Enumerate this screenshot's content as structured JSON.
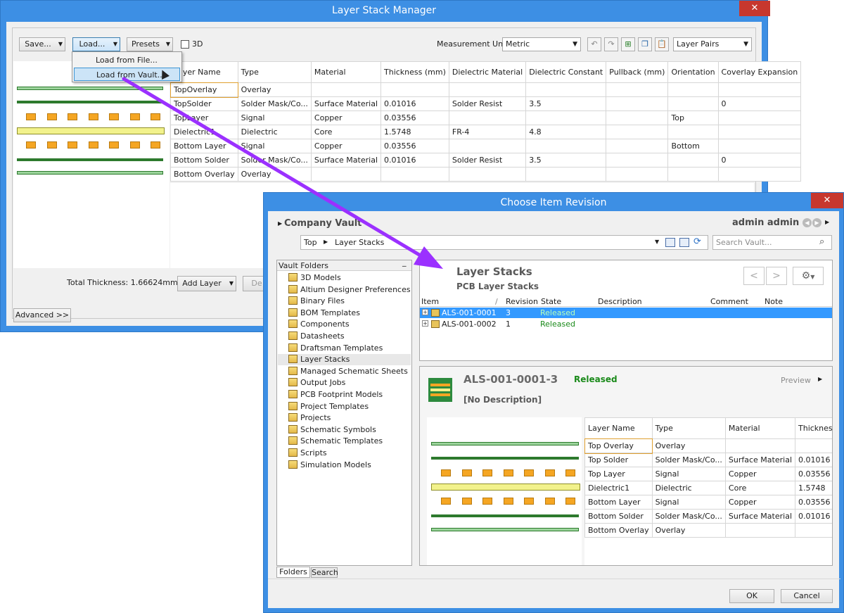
{
  "lsm": {
    "title": "Layer Stack Manager",
    "close": "✕",
    "toolbar": {
      "save": "Save...",
      "load": "Load...",
      "presets": "Presets",
      "three_d": "3D",
      "measurement_label": "Measurement Unit",
      "measurement_value": "Metric",
      "layer_pairs": "Layer Pairs"
    },
    "load_menu": [
      "Load from File...",
      "Load from Vault..."
    ],
    "columns": [
      "Layer Name",
      "Type",
      "Material",
      "Thickness (mm)",
      "Dielectric Material",
      "Dielectric Constant",
      "Pullback (mm)",
      "Orientation",
      "Coverlay Expansion"
    ],
    "rows": [
      [
        "TopOverlay",
        "Overlay",
        "",
        "",
        "",
        "",
        "",
        "",
        ""
      ],
      [
        "TopSolder",
        "Solder Mask/Co...",
        "Surface Material",
        "0.01016",
        "Solder Resist",
        "3.5",
        "",
        "",
        "0"
      ],
      [
        "TopLayer",
        "Signal",
        "Copper",
        "0.03556",
        "",
        "",
        "",
        "Top",
        ""
      ],
      [
        "Dielectric1",
        "Dielectric",
        "Core",
        "1.5748",
        "FR-4",
        "4.8",
        "",
        "",
        ""
      ],
      [
        "Bottom Layer",
        "Signal",
        "Copper",
        "0.03556",
        "",
        "",
        "",
        "Bottom",
        ""
      ],
      [
        "Bottom Solder",
        "Solder Mask/Co...",
        "Surface Material",
        "0.01016",
        "Solder Resist",
        "3.5",
        "",
        "",
        "0"
      ],
      [
        "Bottom Overlay",
        "Overlay",
        "",
        "",
        "",
        "",
        "",
        "",
        ""
      ]
    ],
    "total_thickness": "Total Thickness: 1.66624mm",
    "add_layer": "Add Layer",
    "delete_partial": "De",
    "advanced": "Advanced >>"
  },
  "cir": {
    "title": "Choose Item Revision",
    "close": "✕",
    "vault_name": "Company Vault",
    "user": "admin admin",
    "breadcrumb": [
      "Top",
      "Layer Stacks"
    ],
    "search_placeholder": "Search Vault...",
    "folders_header": "Vault Folders",
    "folders": [
      "3D Models",
      "Altium Designer Preferences",
      "Binary Files",
      "BOM Templates",
      "Components",
      "Datasheets",
      "Draftsman Templates",
      "Layer Stacks",
      "Managed Schematic Sheets",
      "Output Jobs",
      "PCB Footprint Models",
      "Project Templates",
      "Projects",
      "Schematic Symbols",
      "Schematic Templates",
      "Scripts",
      "Simulation Models"
    ],
    "selected_folder": "Layer Stacks",
    "folder_title": "Layer Stacks",
    "folder_subtitle": "PCB Layer Stacks",
    "item_columns": [
      "Item",
      "Revision",
      "State",
      "Description",
      "Comment",
      "Note"
    ],
    "items": [
      {
        "item": "ALS-001-0001",
        "revision": "3",
        "state": "Released"
      },
      {
        "item": "ALS-001-0002",
        "revision": "1",
        "state": "Released"
      }
    ],
    "detail_title": "ALS-001-0001-3",
    "detail_state": "Released",
    "detail_desc": "[No Description]",
    "preview_label": "Preview",
    "detail_columns": [
      "Layer Name",
      "Type",
      "Material",
      "Thickness (mm"
    ],
    "detail_rows": [
      [
        "Top Overlay",
        "Overlay",
        "",
        ""
      ],
      [
        "Top Solder",
        "Solder Mask/Co...",
        "Surface Material",
        "0.01016"
      ],
      [
        "Top Layer",
        "Signal",
        "Copper",
        "0.03556"
      ],
      [
        "Dielectric1",
        "Dielectric",
        "Core",
        "1.5748"
      ],
      [
        "Bottom Layer",
        "Signal",
        "Copper",
        "0.03556"
      ],
      [
        "Bottom Solder",
        "Solder Mask/Co...",
        "Surface Material",
        "0.01016"
      ],
      [
        "Bottom Overlay",
        "Overlay",
        "",
        ""
      ]
    ],
    "tabs": [
      "Folders",
      "Search"
    ],
    "ok": "OK",
    "cancel": "Cancel"
  },
  "colors": {
    "titlebar": "#3d8fe4",
    "close": "#c7372e",
    "released": "#1a8a1a",
    "selection": "#3399ff",
    "arrow": "#9b30ff"
  }
}
